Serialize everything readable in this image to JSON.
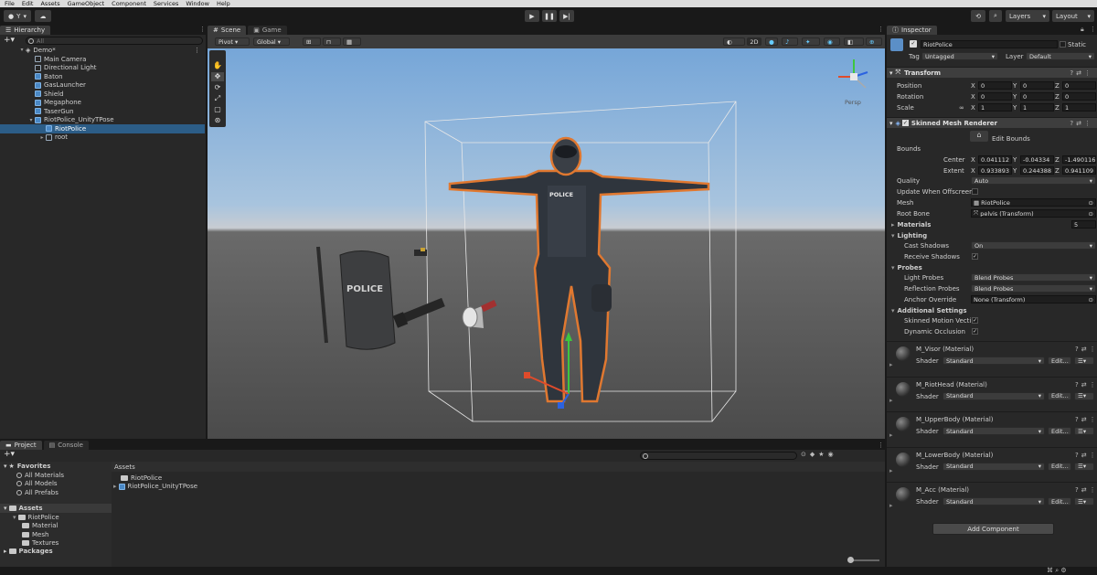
{
  "menu": [
    "File",
    "Edit",
    "Assets",
    "GameObject",
    "Component",
    "Services",
    "Window",
    "Help"
  ],
  "toolbar": {
    "account": "Y",
    "layers": "Layers",
    "layout": "Layout"
  },
  "hierarchy": {
    "tab": "Hierarchy",
    "search_placeholder": "All",
    "scene": "Demo*",
    "items": [
      {
        "label": "Main Camera",
        "indent": 1,
        "sel": false,
        "blue": false
      },
      {
        "label": "Directional Light",
        "indent": 1,
        "sel": false,
        "blue": false
      },
      {
        "label": "Baton",
        "indent": 1,
        "sel": false,
        "blue": true
      },
      {
        "label": "GasLauncher",
        "indent": 1,
        "sel": false,
        "blue": true
      },
      {
        "label": "Shield",
        "indent": 1,
        "sel": false,
        "blue": true
      },
      {
        "label": "Megaphone",
        "indent": 1,
        "sel": false,
        "blue": true
      },
      {
        "label": "TaserGun",
        "indent": 1,
        "sel": false,
        "blue": true
      },
      {
        "label": "RiotPolice_UnityTPose",
        "indent": 1,
        "sel": false,
        "blue": true
      },
      {
        "label": "RiotPolice",
        "indent": 2,
        "sel": true,
        "blue": true
      },
      {
        "label": "root",
        "indent": 2,
        "sel": false,
        "blue": false
      }
    ]
  },
  "scene_tabs": {
    "scene": "Scene",
    "game": "Game"
  },
  "scene_toolbar": {
    "pivot": "Pivot",
    "global": "Global",
    "mode2d": "2D",
    "persp": "Persp"
  },
  "shield_text": "POLICE",
  "vest_text": "POLICE",
  "project": {
    "tab_project": "Project",
    "tab_console": "Console",
    "favorites": "Favorites",
    "fav_items": [
      "All Materials",
      "All Models",
      "All Prefabs"
    ],
    "assets": "Assets",
    "tree": [
      {
        "label": "RiotPolice",
        "indent": 1
      },
      {
        "label": "Material",
        "indent": 2
      },
      {
        "label": "Mesh",
        "indent": 2
      },
      {
        "label": "Textures",
        "indent": 2
      }
    ],
    "packages": "Packages",
    "breadcrumb": "Assets",
    "files": [
      "RiotPolice",
      "RiotPolice_UnityTPose"
    ]
  },
  "inspector": {
    "tab": "Inspector",
    "name": "RiotPolice",
    "static": "Static",
    "tag_label": "Tag",
    "tag": "Untagged",
    "layer_label": "Layer",
    "layer": "Default",
    "transform": {
      "title": "Transform",
      "position_label": "Position",
      "rotation_label": "Rotation",
      "scale_label": "Scale",
      "position": [
        "0",
        "0",
        "0"
      ],
      "rotation": [
        "0",
        "0",
        "0"
      ],
      "scale": [
        "1",
        "1",
        "1"
      ]
    },
    "smr": {
      "title": "Skinned Mesh Renderer",
      "edit_bounds": "Edit Bounds",
      "bounds": "Bounds",
      "center_label": "Center",
      "extent_label": "Extent",
      "center": [
        "0.041112",
        "-0.04334",
        "-1.490116"
      ],
      "extent": [
        "0.933893",
        "0.244388",
        "0.941109"
      ],
      "quality_label": "Quality",
      "quality": "Auto",
      "update_label": "Update When Offscreen",
      "mesh_label": "Mesh",
      "mesh": "RiotPolice",
      "rootbone_label": "Root Bone",
      "rootbone": "pelvis (Transform)",
      "materials_label": "Materials",
      "materials_count": "5",
      "lighting": "Lighting",
      "cast_label": "Cast Shadows",
      "cast": "On",
      "receive_label": "Receive Shadows",
      "probes": "Probes",
      "light_probes_label": "Light Probes",
      "light_probes": "Blend Probes",
      "refl_probes_label": "Reflection Probes",
      "refl_probes": "Blend Probes",
      "anchor_label": "Anchor Override",
      "anchor": "None (Transform)",
      "additional": "Additional Settings",
      "motion_label": "Skinned Motion Vecti",
      "occlusion_label": "Dynamic Occlusion"
    },
    "materials": [
      {
        "name": "M_Visor (Material)",
        "shader": "Standard"
      },
      {
        "name": "M_RiotHead (Material)",
        "shader": "Standard"
      },
      {
        "name": "M_UpperBody (Material)",
        "shader": "Standard"
      },
      {
        "name": "M_LowerBody (Material)",
        "shader": "Standard"
      },
      {
        "name": "M_Acc (Material)",
        "shader": "Standard"
      }
    ],
    "shader_label": "Shader",
    "edit_label": "Edit...",
    "add_component": "Add Component"
  }
}
